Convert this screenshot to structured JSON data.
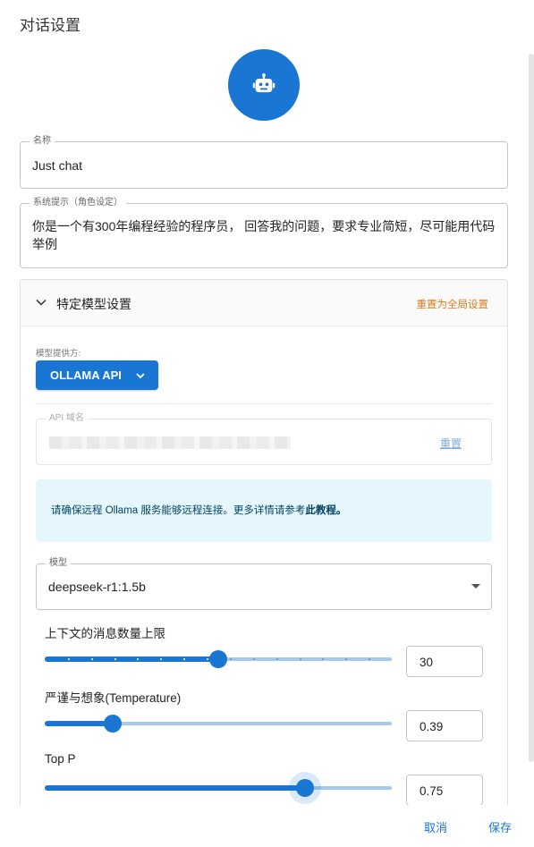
{
  "dialog": {
    "title": "对话设置"
  },
  "avatar": {
    "icon": "robot-icon",
    "color": "#1976d2"
  },
  "name_field": {
    "label": "名称",
    "value": "Just chat"
  },
  "prompt_field": {
    "label": "系统提示（角色设定）",
    "value": "你是一个有300年编程经验的程序员， 回答我的问题，要求专业简短，尽可能用代码举例"
  },
  "model_settings": {
    "title": "特定模型设置",
    "reset_global": "重置为全局设置",
    "provider_label": "模型提供方:",
    "provider_value": "OLLAMA API",
    "api_host_label": "API 域名",
    "api_host_reset": "重置",
    "info_text": "请确保远程 Ollama 服务能够远程连接。更多详情请参考",
    "info_link": "此教程。",
    "model_label": "模型",
    "model_value": "deepseek-r1:1.5b",
    "context": {
      "label": "上下文的消息数量上限",
      "value": "30",
      "fraction": 0.5
    },
    "temperature": {
      "label": "严谨与想象(Temperature)",
      "value": "0.39",
      "fraction": 0.195
    },
    "top_p": {
      "label": "Top P",
      "value": "0.75",
      "fraction": 0.75
    }
  },
  "footer": {
    "cancel": "取消",
    "save": "保存"
  },
  "colors": {
    "primary": "#1976d2",
    "warning": "#e07b1a",
    "info_bg": "#e5f6fd"
  }
}
